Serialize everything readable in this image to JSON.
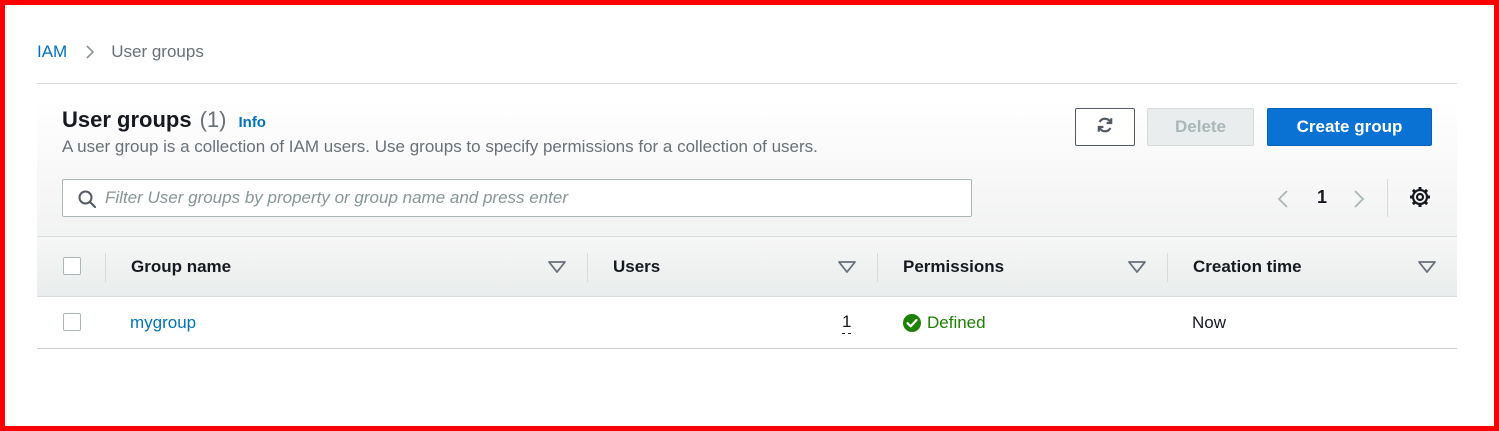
{
  "breadcrumb": {
    "root": "IAM",
    "current": "User groups"
  },
  "header": {
    "title": "User groups",
    "count": "(1)",
    "info": "Info",
    "description": "A user group is a collection of IAM users. Use groups to specify permissions for a collection of users."
  },
  "toolbar": {
    "delete_label": "Delete",
    "create_label": "Create group"
  },
  "search": {
    "placeholder": "Filter User groups by property or group name and press enter",
    "value": ""
  },
  "pagination": {
    "current_page": "1"
  },
  "table": {
    "columns": [
      "Group name",
      "Users",
      "Permissions",
      "Creation time"
    ],
    "rows": [
      {
        "group_name": "mygroup",
        "users": "1",
        "permissions": "Defined",
        "creation_time": "Now"
      }
    ]
  },
  "icons": {
    "refresh": "refresh-icon",
    "search": "search-icon",
    "settings": "gear-icon",
    "status": "check-circle-icon"
  },
  "colors": {
    "link": "#0073bb",
    "primary_button": "#0972d3",
    "status_success": "#1d8102",
    "disabled_text": "#aab7b8"
  }
}
